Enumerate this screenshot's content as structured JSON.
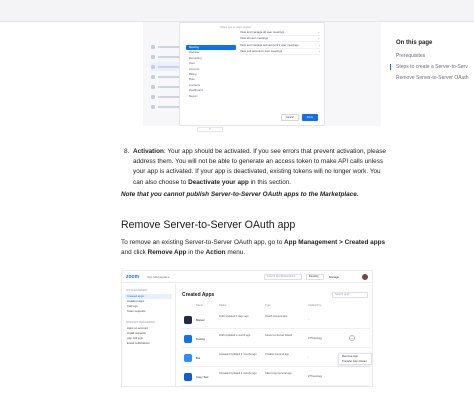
{
  "screenshot1": {
    "hint": "Select one or more scopes",
    "categories": [
      "Meeting",
      "Webinar",
      "Recording",
      "User",
      "Account",
      "Billing",
      "Role",
      "Contacts",
      "Dashboard",
      "Report"
    ],
    "scopes": [
      "View and manage all user meetings",
      "View all user meetings",
      "View and manage sub account's user meetings",
      "View sub account's user meetings"
    ],
    "cancel": "Cancel",
    "done": "Done"
  },
  "toc": {
    "title": "On this page",
    "items": [
      "Prerequisites",
      "Steps to create a Server-to-Serv",
      "Remove Server-to-Server OAuth"
    ]
  },
  "article": {
    "step_number": "8.",
    "step_lead": "Activation",
    "step_text_1": ": Your app should be activated. If you see errors that prevent activation, please address them. You will not be able to generate an access token to make API calls unless your app is activated. If your app is deactivated, existing tokens will no longer work. You can also choose to ",
    "step_bold": "Deactivate your app",
    "step_text_2": " in this section.",
    "note": "Note that you cannot publish Server-to-Server OAuth apps to the Marketplace.",
    "section_title": "Remove Server-to-Server OAuth app",
    "para_1": "To remove an existing Server-to-Server OAuth app, go to ",
    "para_bold_1": "App Management > Created apps",
    "para_2": " and click ",
    "para_bold_2": "Remove App",
    "para_3": " in the ",
    "para_bold_3": "Action",
    "para_4": " menu."
  },
  "screenshot2": {
    "logo": "zoom",
    "subtitle": "App Marketplace",
    "search_placeholder": "Search App Marketplace",
    "develop": "Develop",
    "manage": "Manage",
    "nav": {
      "group1": "APP MANAGEMENT",
      "items1": [
        "Created apps",
        "Installed apps",
        "Call logs",
        "Team requests"
      ],
      "group2": "ADMIN APP MANAGEMENT",
      "items2": [
        "Apps on account",
        "Install requests",
        "App call logs",
        "Email notifications"
      ]
    },
    "title": "Created Apps",
    "filter_placeholder": "Search apps",
    "columns": [
      "Name",
      "Status",
      "Type",
      "Updated by"
    ],
    "rows": [
      {
        "name": "Marvel",
        "status": "Draft Updated 2 days ago",
        "type": "OAuth General app",
        "updated": "-",
        "color": "#1f2a44"
      },
      {
        "name": "Testing",
        "status": "Draft Updated a month ago",
        "type": "Server-to-Server OAuth",
        "updated": "ZTTestology",
        "color": "#0e72ed"
      },
      {
        "name": "Bot",
        "status": "Activated Updated 3 months ago",
        "type": "Chatbot General app",
        "updated": "-",
        "color": "#2d8cff"
      },
      {
        "name": "Copy Test",
        "status": "Activated Updated 3 months ago",
        "type": "Client App General app",
        "updated": "ZTTestology",
        "color": "#0b5cd5"
      }
    ],
    "menu": [
      "Remove App",
      "Transfer App Owner"
    ]
  }
}
